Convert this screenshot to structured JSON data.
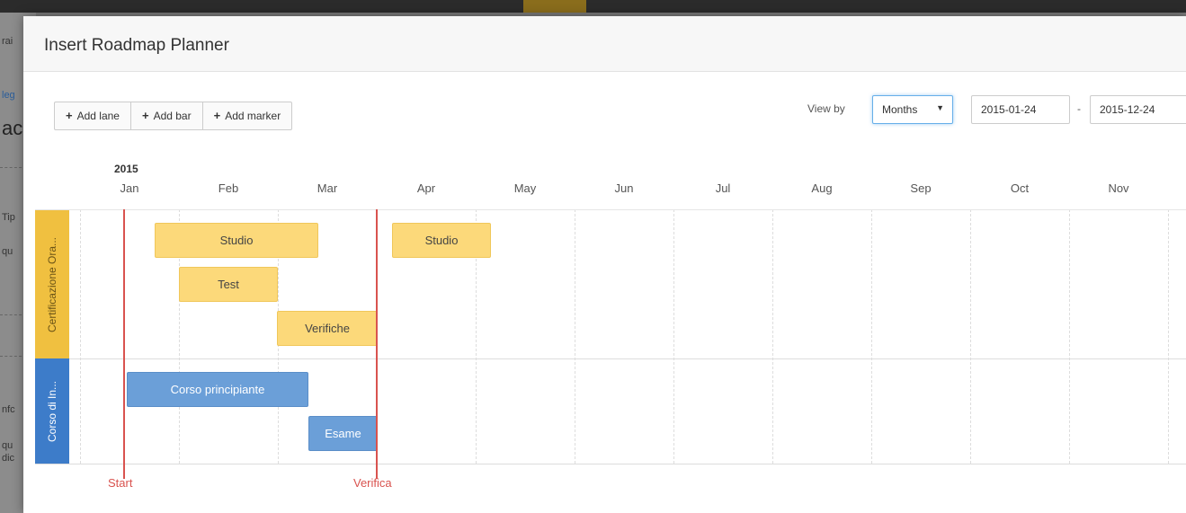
{
  "background": {
    "fragments": [
      "rai",
      "leg",
      "ac",
      "Tip",
      "qu",
      "nfc",
      "qu",
      "dic"
    ]
  },
  "modal": {
    "title": "Insert Roadmap Planner"
  },
  "toolbar": {
    "add_lane": "Add lane",
    "add_bar": "Add bar",
    "add_marker": "Add marker"
  },
  "view": {
    "label": "View by",
    "selected": "Months",
    "start_date": "2015-01-24",
    "separator": "-",
    "end_date": "2015-12-24"
  },
  "timeline": {
    "year": "2015",
    "months": [
      "Jan",
      "Feb",
      "Mar",
      "Apr",
      "May",
      "Jun",
      "Jul",
      "Aug",
      "Sep",
      "Oct",
      "Nov"
    ]
  },
  "lanes": [
    {
      "title": "Certificazione Ora...",
      "color": "#f0c040",
      "bars": [
        {
          "label": "Studio"
        },
        {
          "label": "Test"
        },
        {
          "label": "Verifiche"
        },
        {
          "label": "Studio"
        }
      ]
    },
    {
      "title": "Corso di In...",
      "color": "#3d7cc9",
      "bars": [
        {
          "label": "Corso principiante"
        },
        {
          "label": "Esame"
        }
      ]
    }
  ],
  "markers": [
    {
      "label": "Start",
      "color": "#d9534f"
    },
    {
      "label": "Verifica",
      "color": "#d9534f"
    }
  ]
}
